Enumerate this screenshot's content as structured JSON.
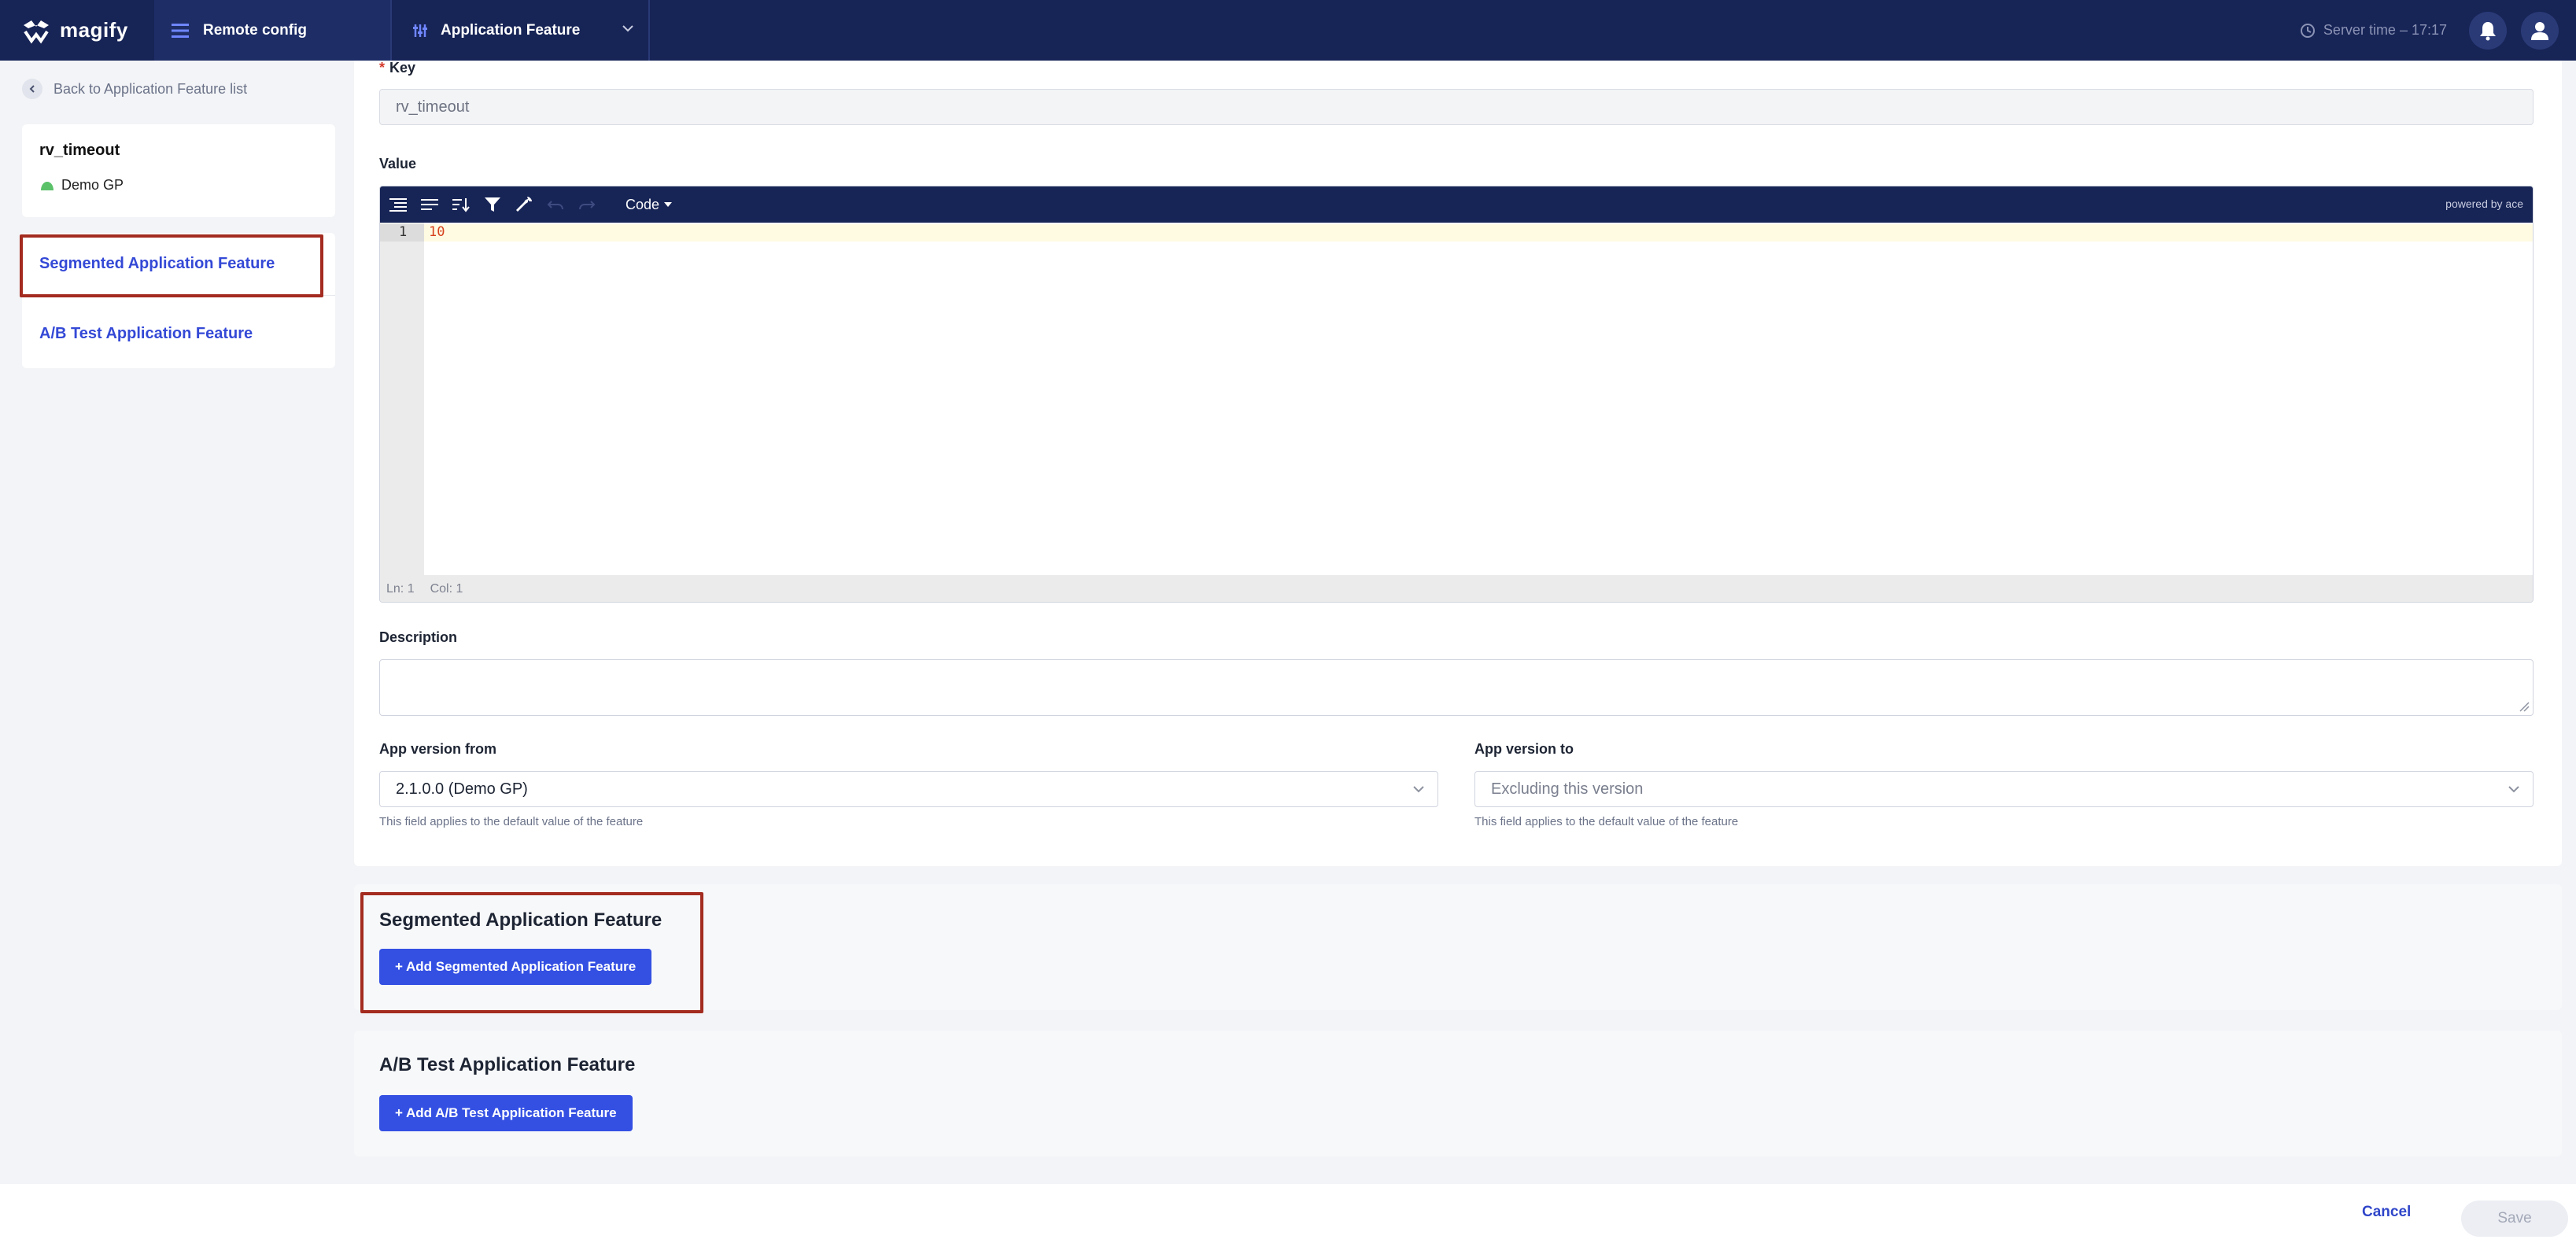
{
  "topbar": {
    "brand": "magify",
    "section_label": "Remote config",
    "feature_label": "Application Feature",
    "server_time": "Server time – 17:17"
  },
  "sidebar": {
    "back_link": "Back to Application Feature list",
    "feature_key": "rv_timeout",
    "app_name": "Demo GP",
    "nav": [
      {
        "label": "Segmented Application Feature"
      },
      {
        "label": "A/B Test Application Feature"
      }
    ]
  },
  "form": {
    "key_required_mark": "*",
    "key_label": "Key",
    "key_value": "rv_timeout",
    "value_label": "Value",
    "editor": {
      "mode_label": "Code",
      "powered_by": "powered by ace",
      "line_number": "1",
      "code": "10",
      "status_ln": "Ln: 1",
      "status_col": "Col: 1"
    },
    "description_label": "Description",
    "description_value": "",
    "app_version_from_label": "App version from",
    "app_version_from_value": "2.1.0.0 (Demo GP)",
    "app_version_from_hint": "This field applies to the default value of the feature",
    "app_version_to_label": "App version to",
    "app_version_to_value": "Excluding this version",
    "app_version_to_hint": "This field applies to the default value of the feature"
  },
  "sections": {
    "segmented": {
      "title": "Segmented Application Feature",
      "button": "+ Add Segmented Application Feature"
    },
    "abtest": {
      "title": "A/B Test Application Feature",
      "button": "+ Add A/B Test Application Feature"
    }
  },
  "footer": {
    "cancel": "Cancel",
    "save": "Save"
  },
  "colors": {
    "nav_bg": "#172456",
    "primary": "#3450e3",
    "link": "#3449d6",
    "highlight": "#a32b1f"
  },
  "icons": [
    "magify-logo-icon",
    "menu-icon",
    "sliders-icon",
    "chevron-down-icon",
    "clock-icon",
    "bell-icon",
    "user-icon",
    "chevron-left-icon",
    "android-icon",
    "format-icon",
    "compact-icon",
    "sort-icon",
    "filter-icon",
    "wrench-icon",
    "undo-icon",
    "redo-icon"
  ]
}
